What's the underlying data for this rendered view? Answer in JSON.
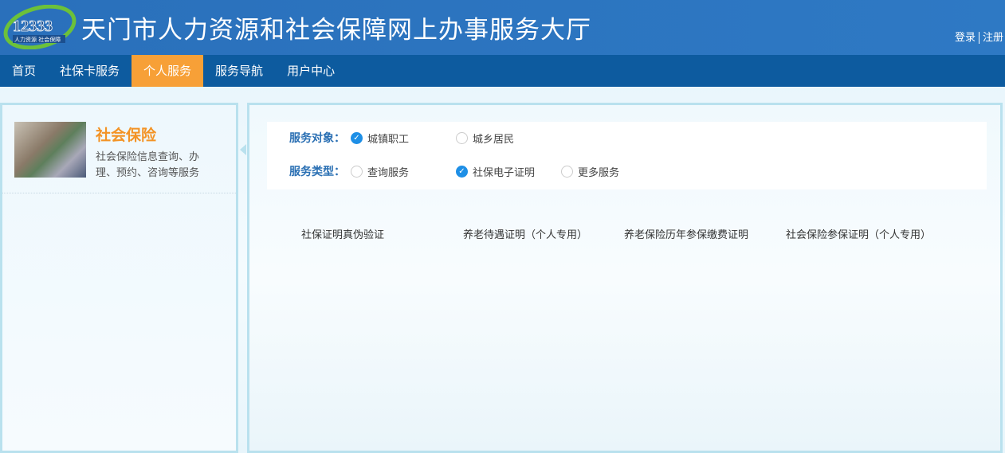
{
  "header": {
    "logo_number": "12333",
    "logo_sub": "人力资源 社会保障",
    "title": "天门市人力资源和社会保障网上办事服务大厅",
    "login": "登录",
    "register": "注册"
  },
  "nav": [
    {
      "label": "首页"
    },
    {
      "label": "社保卡服务"
    },
    {
      "label": "个人服务",
      "active": true
    },
    {
      "label": "服务导航"
    },
    {
      "label": "用户中心"
    }
  ],
  "sidebar": {
    "title": "社会保险",
    "desc": "社会保险信息查询、办理、预约、咨询等服务"
  },
  "filters": {
    "target": {
      "label": "服务对象：",
      "options": [
        {
          "label": "城镇职工",
          "checked": true
        },
        {
          "label": "城乡居民",
          "checked": false
        }
      ]
    },
    "type": {
      "label": "服务类型：",
      "options": [
        {
          "label": "查询服务",
          "checked": false
        },
        {
          "label": "社保电子证明",
          "checked": true
        },
        {
          "label": "更多服务",
          "checked": false
        }
      ]
    }
  },
  "services": [
    "社保证明真伪验证",
    "养老待遇证明（个人专用）",
    "养老保险历年参保缴费证明",
    "社会保险参保证明（个人专用）"
  ],
  "colors": {
    "header": "#2b74bf",
    "nav": "#0d5b9f",
    "active": "#f7a037",
    "accent": "#f39325"
  }
}
